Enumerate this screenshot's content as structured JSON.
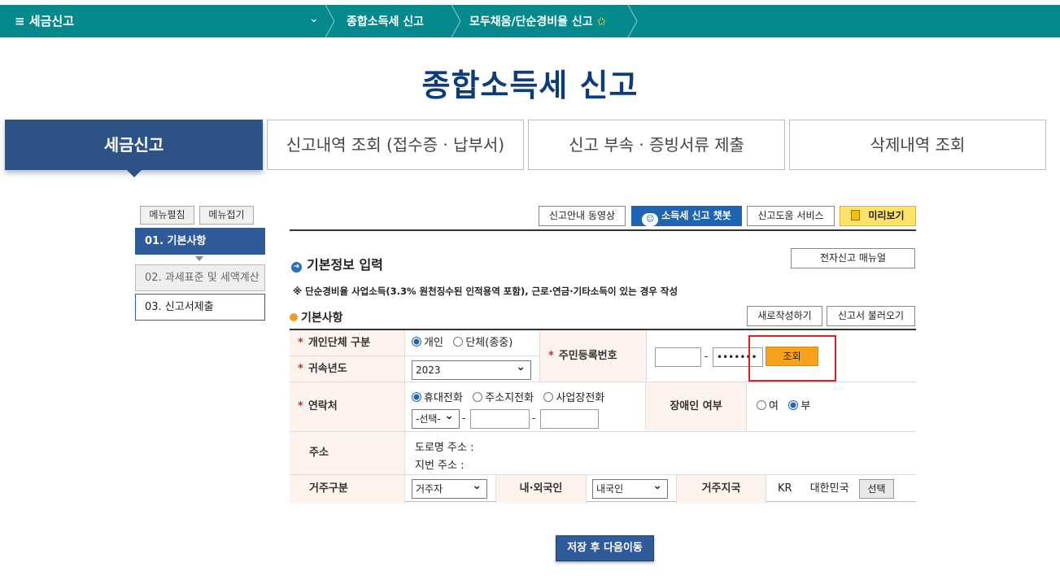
{
  "topbar": {
    "menu_label": "≡  세금신고",
    "crumbs": [
      "종합소득세 신고",
      "모두채움/단순경비율 신고"
    ],
    "star": "✩"
  },
  "title": "종합소득세 신고",
  "tabs": [
    "세금신고",
    "신고내역 조회 (접수증 · 납부서)",
    "신고 부속 · 증빙서류 제출",
    "삭제내역 조회"
  ],
  "side": {
    "expand": "메뉴펼침",
    "collapse": "메뉴접기",
    "steps": [
      "01. 기본사항",
      "02. 과세표준 및 세액계산",
      "03. 신고서제출"
    ]
  },
  "toolbar": {
    "video": "신고안내 동영상",
    "chatbot": "소득세 신고 챗봇",
    "help": "신고도움 서비스",
    "preview": "미리보기",
    "manual": "전자신고 매뉴얼"
  },
  "section_title": "기본정보 입력",
  "notice": "※ 단순경비율 사업소득(3.3% 원천징수된 인적용역 포함), 근로·연금·기타소득이 있는 경우 작성",
  "subhead": "기본사항",
  "actions": {
    "new": "새로작성하기",
    "load": "신고서 불러오기"
  },
  "form": {
    "type_label": "개인단체 구분",
    "type_options": [
      "개인",
      "단체(종중)"
    ],
    "year_label": "귀속년도",
    "year_value": "2023",
    "rrn_label": "주민등록번호",
    "rrn_first": "",
    "rrn_dash": "-",
    "rrn_second": "•••••••",
    "lookup": "조회",
    "contact_label": "연락처",
    "contact_options": [
      "휴대전화",
      "주소지전화",
      "사업장전화"
    ],
    "phone_select": "-선택-",
    "phone_dash1": "-",
    "phone_dash2": "-",
    "disabled_label": "장애인 여부",
    "disabled_options": [
      "여",
      "부"
    ],
    "address_label": "주소",
    "road_address": "도로명 주소 :",
    "lot_address": "지번 주소 :",
    "residence_label": "거주구분",
    "residence_value": "거주자",
    "nationality_label": "내·외국인",
    "nationality_value": "내국인",
    "region_label": "거주지국",
    "region_code": "KR",
    "region_name": "대한민국",
    "region_select": "선택"
  },
  "save": "저장 후 다음이동"
}
